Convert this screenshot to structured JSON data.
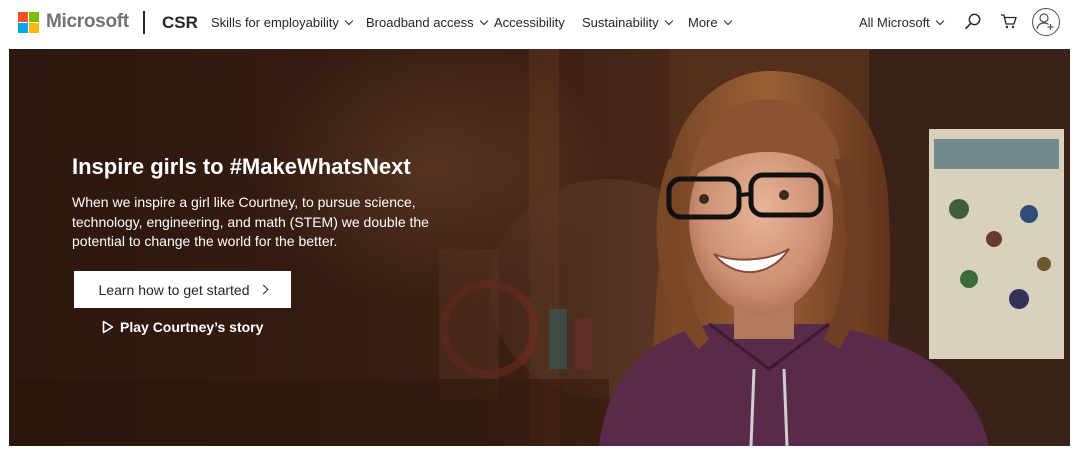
{
  "brand": {
    "logo_text": "Microsoft",
    "logo_colors": [
      "#f25022",
      "#7fba00",
      "#00a4ef",
      "#ffb900"
    ],
    "site_name": "CSR"
  },
  "nav": {
    "items": [
      {
        "label": "Skills for employability",
        "has_dropdown": true
      },
      {
        "label": "Broadband access",
        "has_dropdown": true
      },
      {
        "label": "Accessibility",
        "has_dropdown": false
      },
      {
        "label": "Sustainability",
        "has_dropdown": true
      },
      {
        "label": "More",
        "has_dropdown": true
      }
    ],
    "all_microsoft": "All Microsoft",
    "icons": [
      "search-icon",
      "cart-icon",
      "account-icon"
    ]
  },
  "hero": {
    "headline": "Inspire girls to #MakeWhatsNext",
    "body": "When we inspire a girl like Courtney, to pursue science, technology, engineering, and math (STEM) we double the potential to change the world for the better.",
    "cta_label": "Learn how to get started",
    "play_label": "Play Courtney’s story"
  }
}
